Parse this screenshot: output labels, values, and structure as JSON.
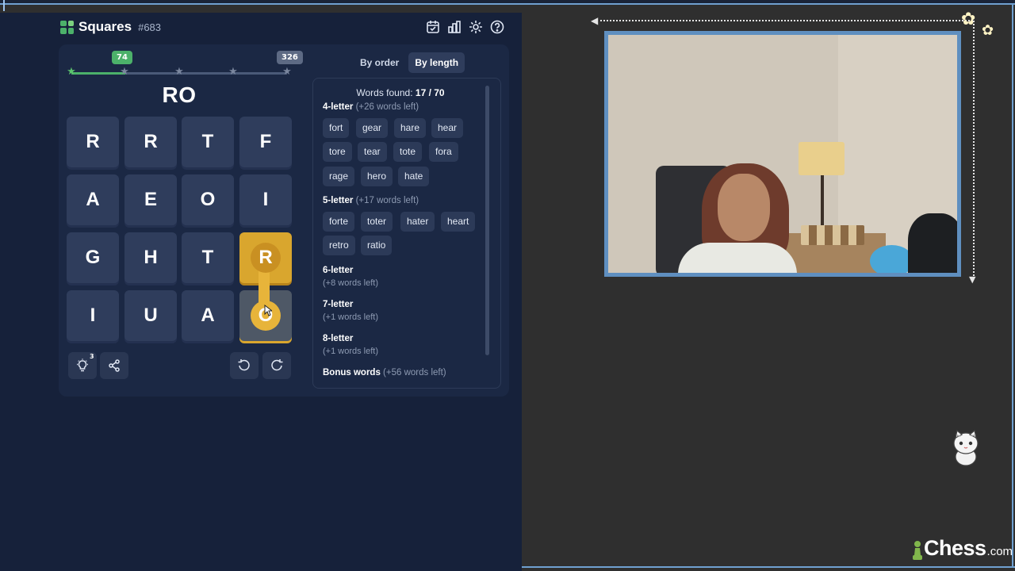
{
  "game": {
    "title": "Squares",
    "puzzle_number": "#683",
    "progress": {
      "min_badge": "74",
      "max_badge": "326",
      "filled_fraction": 0.25
    },
    "current_word": "RO",
    "grid": [
      [
        "R",
        "R",
        "T",
        "F"
      ],
      [
        "A",
        "E",
        "O",
        "I"
      ],
      [
        "G",
        "H",
        "T",
        "R"
      ],
      [
        "I",
        "U",
        "A",
        "O"
      ]
    ],
    "selected_tiles": [
      "row3-col4",
      "row4-col4"
    ],
    "hint_count": "3",
    "tabs": [
      "By order",
      "By length"
    ],
    "active_tab": "By length",
    "words_found": {
      "label": "Words found:",
      "value": "17 / 70"
    },
    "sections": [
      {
        "title": "4-letter",
        "note": "(+26 words left)",
        "words": [
          "fort",
          "gear",
          "hare",
          "hear",
          "tore",
          "tear",
          "tote",
          "fora",
          "rage",
          "hero",
          "hate"
        ]
      },
      {
        "title": "5-letter",
        "note": "(+17 words left)",
        "words": [
          "forte",
          "toter",
          "hater",
          "heart",
          "retro",
          "ratio"
        ]
      },
      {
        "title": "6-letter",
        "note": "(+8 words left)"
      },
      {
        "title": "7-letter",
        "note": "(+1 words left)"
      },
      {
        "title": "8-letter",
        "note": "(+1 words left)"
      },
      {
        "title": "Bonus words",
        "note": "(+56 words left)"
      }
    ]
  },
  "icons": {
    "header": [
      "calendar-icon",
      "stats-icon",
      "gear-icon",
      "help-icon"
    ],
    "tools": [
      "lightbulb-icon",
      "share-icon",
      "rotate-left-icon",
      "rotate-right-icon"
    ]
  },
  "branding": {
    "name": "Chess",
    "tld": ".com"
  },
  "colors": {
    "panel_bg": "#16213a",
    "tile": "#2f3d5c",
    "selected": "#d9a62e",
    "progress": "#4cb16a",
    "frame": "#5f8fc0"
  }
}
